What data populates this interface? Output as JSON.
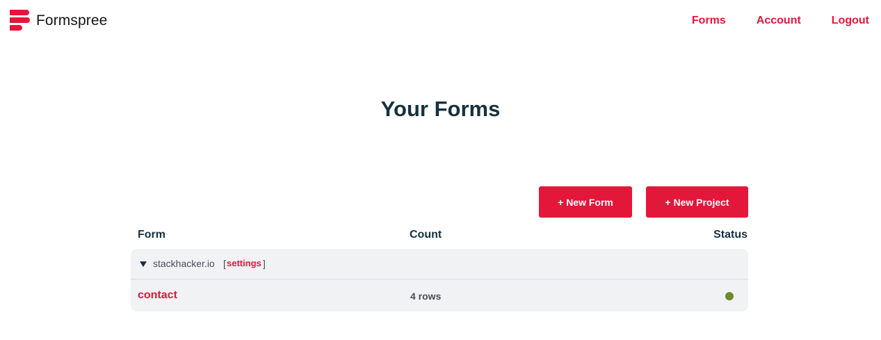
{
  "brand": {
    "name": "Formspree",
    "logo_icon": "formspree-logo-icon"
  },
  "nav": {
    "items": [
      {
        "label": "Forms"
      },
      {
        "label": "Account"
      },
      {
        "label": "Logout"
      }
    ]
  },
  "page": {
    "title": "Your Forms"
  },
  "actions": {
    "new_form_label": "+ New Form",
    "new_project_label": "+ New Project"
  },
  "table": {
    "headers": {
      "form": "Form",
      "count": "Count",
      "status": "Status"
    },
    "projects": [
      {
        "name": "stackhacker.io",
        "bracket_open": "[",
        "settings_label": "settings",
        "bracket_close": "]",
        "expanded": true,
        "forms": [
          {
            "name": "contact",
            "count": "4 rows",
            "status_color": "#6e8a2c"
          }
        ]
      }
    ]
  },
  "colors": {
    "accent": "#e3173a",
    "heading": "#15313f",
    "card_bg": "#f1f2f4"
  }
}
